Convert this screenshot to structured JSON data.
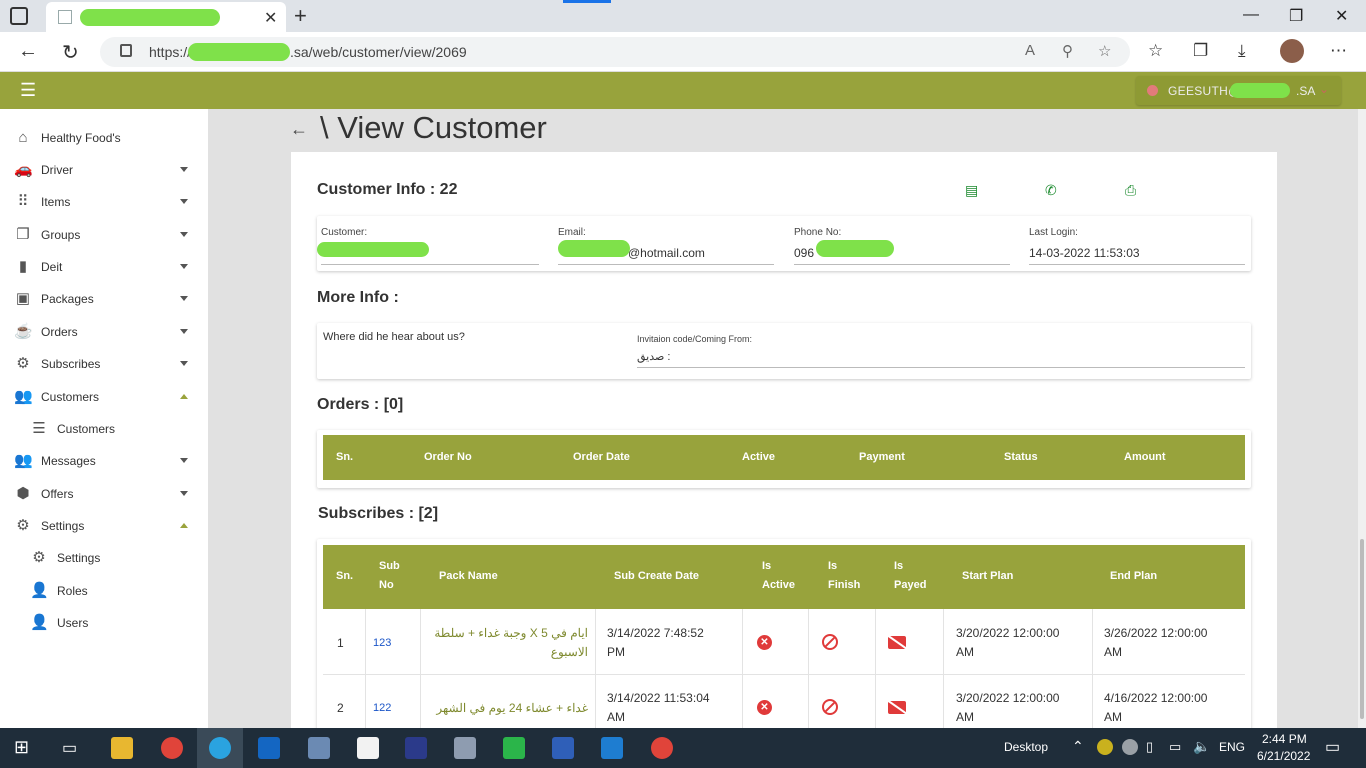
{
  "browser": {
    "tab_close": "✕",
    "new_tab": "+",
    "url_prefix": "https://",
    "url_suffix": ".sa/web/customer/view/2069",
    "window_min": "—",
    "window_max": "❐",
    "window_close": "✕"
  },
  "app": {
    "user_prefix": "GEESUTH@",
    "user_suffix": ".SA"
  },
  "sidebar": {
    "items": [
      {
        "label": "Healthy Food's",
        "icon": "home-icon",
        "glyph": "⌂"
      },
      {
        "label": "Driver",
        "icon": "car-icon",
        "glyph": "🚗"
      },
      {
        "label": "Items",
        "icon": "grid-icon",
        "glyph": "⠿"
      },
      {
        "label": "Groups",
        "icon": "layers-icon",
        "glyph": "❐"
      },
      {
        "label": "Deit",
        "icon": "bar-chart-icon",
        "glyph": "▮"
      },
      {
        "label": "Packages",
        "icon": "bag-icon",
        "glyph": "▣"
      },
      {
        "label": "Orders",
        "icon": "food-icon",
        "glyph": "☕"
      },
      {
        "label": "Subscribes",
        "icon": "scooter-icon",
        "glyph": "⚙"
      },
      {
        "label": "Customers",
        "icon": "people-icon",
        "glyph": "👥"
      },
      {
        "label": "Customers",
        "icon": "list-icon",
        "glyph": "☰"
      },
      {
        "label": "Messages",
        "icon": "people-icon",
        "glyph": "👥"
      },
      {
        "label": "Offers",
        "icon": "offer-icon",
        "glyph": "⬢"
      },
      {
        "label": "Settings",
        "icon": "gear-icon",
        "glyph": "⚙"
      },
      {
        "label": "Settings",
        "icon": "gear-icon",
        "glyph": "⚙"
      },
      {
        "label": "Roles",
        "icon": "person-icon",
        "glyph": "👤"
      },
      {
        "label": "Users",
        "icon": "person-icon",
        "glyph": "👤"
      }
    ]
  },
  "page": {
    "back": "←",
    "title": "\\ View Customer",
    "customer_info_title": "Customer Info : 22",
    "labels": {
      "customer": "Customer:",
      "email": "Email:",
      "phone": "Phone No:",
      "last_login": "Last Login:"
    },
    "values": {
      "email_suffix": "@hotmail.com",
      "phone_prefix": "096",
      "last_login": "14-03-2022 11:53:03"
    },
    "more_info_title": "More Info :",
    "hear_about": "Where did he hear about us?",
    "invitation_label": "Invitaion code/Coming From:",
    "invitation_value": "صديق :",
    "orders_title": "Orders : [0]",
    "orders_headers": [
      "Sn.",
      "Order No",
      "Order Date",
      "Active",
      "Payment",
      "Status",
      "Amount"
    ],
    "subscribes_title": "Subscribes : [2]",
    "sub_headers": {
      "sn": "Sn.",
      "sub_no_1": "Sub",
      "sub_no_2": "No",
      "pack_name": "Pack Name",
      "create_date": "Sub Create Date",
      "active_1": "Is",
      "active_2": "Active",
      "finish_1": "Is",
      "finish_2": "Finish",
      "payed_1": "Is",
      "payed_2": "Payed",
      "start": "Start Plan",
      "end": "End Plan"
    },
    "sub_rows": [
      {
        "sn": "1",
        "sub_no": "123",
        "pack_1": "ايام في 5 X وجبة غداء + سلطة",
        "pack_2": "الاسبوع",
        "create_1": "3/14/2022 7:48:52",
        "create_2": "PM",
        "start_1": "3/20/2022 12:00:00",
        "start_2": "AM",
        "end_1": "3/26/2022 12:00:00",
        "end_2": "AM"
      },
      {
        "sn": "2",
        "sub_no": "122",
        "pack_1": "غداء + عشاء 24 يوم في الشهر",
        "pack_2": "",
        "create_1": "3/14/2022 11:53:04",
        "create_2": "AM",
        "start_1": "3/20/2022 12:00:00",
        "start_2": "AM",
        "end_1": "4/16/2022 12:00:00",
        "end_2": "AM"
      }
    ]
  },
  "taskbar": {
    "desktop": "Desktop",
    "lang": "ENG",
    "time": "2:44 PM",
    "date": "6/21/2022"
  },
  "colors": {
    "accent": "#98a33c",
    "danger": "#e03a3a",
    "link": "#1a55c8"
  }
}
